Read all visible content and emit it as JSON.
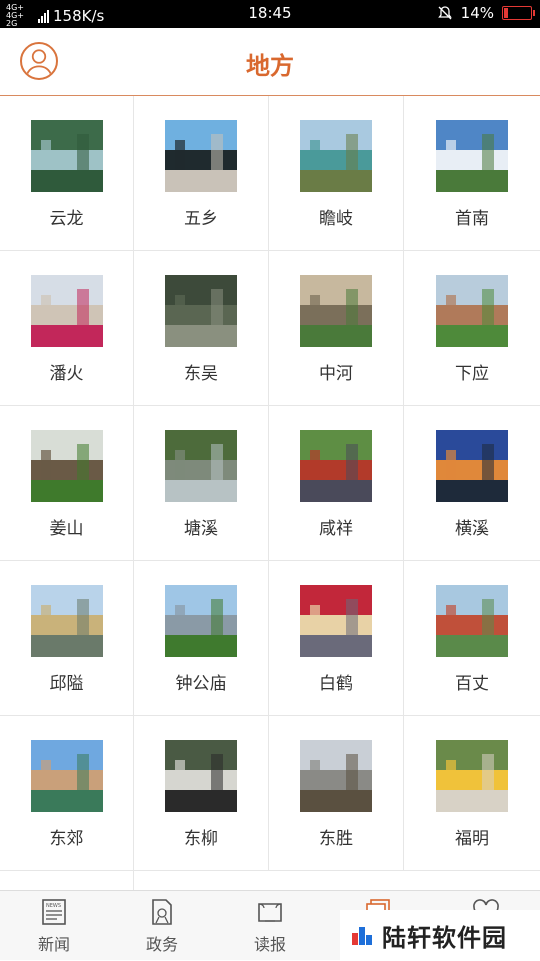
{
  "status": {
    "network": "4G+ 4G+ 2G",
    "speed": "158K/s",
    "time": "18:45",
    "battery": "14%",
    "battery_level": 0.14,
    "battery_color": "#e53935"
  },
  "header": {
    "title": "地方",
    "accent_color": "#d9682e"
  },
  "places": [
    {
      "name": "云龙",
      "thumb_palette": [
        "#3d6b4a",
        "#9ec2c6",
        "#2f5a3b"
      ]
    },
    {
      "name": "五乡",
      "thumb_palette": [
        "#6fb0e0",
        "#1f2a2e",
        "#c9c2b8"
      ]
    },
    {
      "name": "瞻岐",
      "thumb_palette": [
        "#a9c9e0",
        "#4a9a9a",
        "#6a7c46"
      ]
    },
    {
      "name": "首南",
      "thumb_palette": [
        "#4f86c6",
        "#e8eef5",
        "#4a7a3a"
      ]
    },
    {
      "name": "潘火",
      "thumb_palette": [
        "#d6dde6",
        "#cfc4b6",
        "#c2275a"
      ]
    },
    {
      "name": "东吴",
      "thumb_palette": [
        "#3d4a3a",
        "#5a6652",
        "#8a907f"
      ]
    },
    {
      "name": "中河",
      "thumb_palette": [
        "#c7b89e",
        "#7b6f5a",
        "#4a7a3a"
      ]
    },
    {
      "name": "下应",
      "thumb_palette": [
        "#b8ccdc",
        "#b07a5a",
        "#4e8a3a"
      ]
    },
    {
      "name": "姜山",
      "thumb_palette": [
        "#d8ddd6",
        "#6a5a46",
        "#3f7a2c"
      ]
    },
    {
      "name": "塘溪",
      "thumb_palette": [
        "#4d6b3b",
        "#7e8a7b",
        "#b7c2c4"
      ]
    },
    {
      "name": "咸祥",
      "thumb_palette": [
        "#5e8e44",
        "#b23a2a",
        "#4a4a5a"
      ]
    },
    {
      "name": "横溪",
      "thumb_palette": [
        "#2a4a9a",
        "#e0883a",
        "#1e2a3a"
      ]
    },
    {
      "name": "邱隘",
      "thumb_palette": [
        "#b9d3ea",
        "#c9b27a",
        "#6a7a6a"
      ]
    },
    {
      "name": "钟公庙",
      "thumb_palette": [
        "#9fc6e6",
        "#8a9aa6",
        "#3f7a2e"
      ]
    },
    {
      "name": "白鹤",
      "thumb_palette": [
        "#c2273a",
        "#e8d2a6",
        "#6a6a7a"
      ]
    },
    {
      "name": "百丈",
      "thumb_palette": [
        "#a8c8e0",
        "#c0503a",
        "#5a8a4a"
      ]
    },
    {
      "name": "东郊",
      "thumb_palette": [
        "#6fa8e0",
        "#c9a07a",
        "#3a7a5a"
      ]
    },
    {
      "name": "东柳",
      "thumb_palette": [
        "#4a5a44",
        "#d6d6d0",
        "#2a2a2a"
      ]
    },
    {
      "name": "东胜",
      "thumb_palette": [
        "#c9cfd6",
        "#8a8a86",
        "#5a5040"
      ]
    },
    {
      "name": "福明",
      "thumb_palette": [
        "#6a8a4a",
        "#f0c23a",
        "#d8d2c6"
      ]
    }
  ],
  "bottom_nav": [
    {
      "label": "新闻",
      "icon": "newspaper-icon"
    },
    {
      "label": "政务",
      "icon": "government-doc-icon"
    },
    {
      "label": "读报",
      "icon": "read-paper-icon"
    },
    {
      "label": "",
      "icon": "local-pages-icon"
    },
    {
      "label": "",
      "icon": "heart-icon"
    }
  ],
  "watermark": {
    "text": "陆轩软件园"
  }
}
